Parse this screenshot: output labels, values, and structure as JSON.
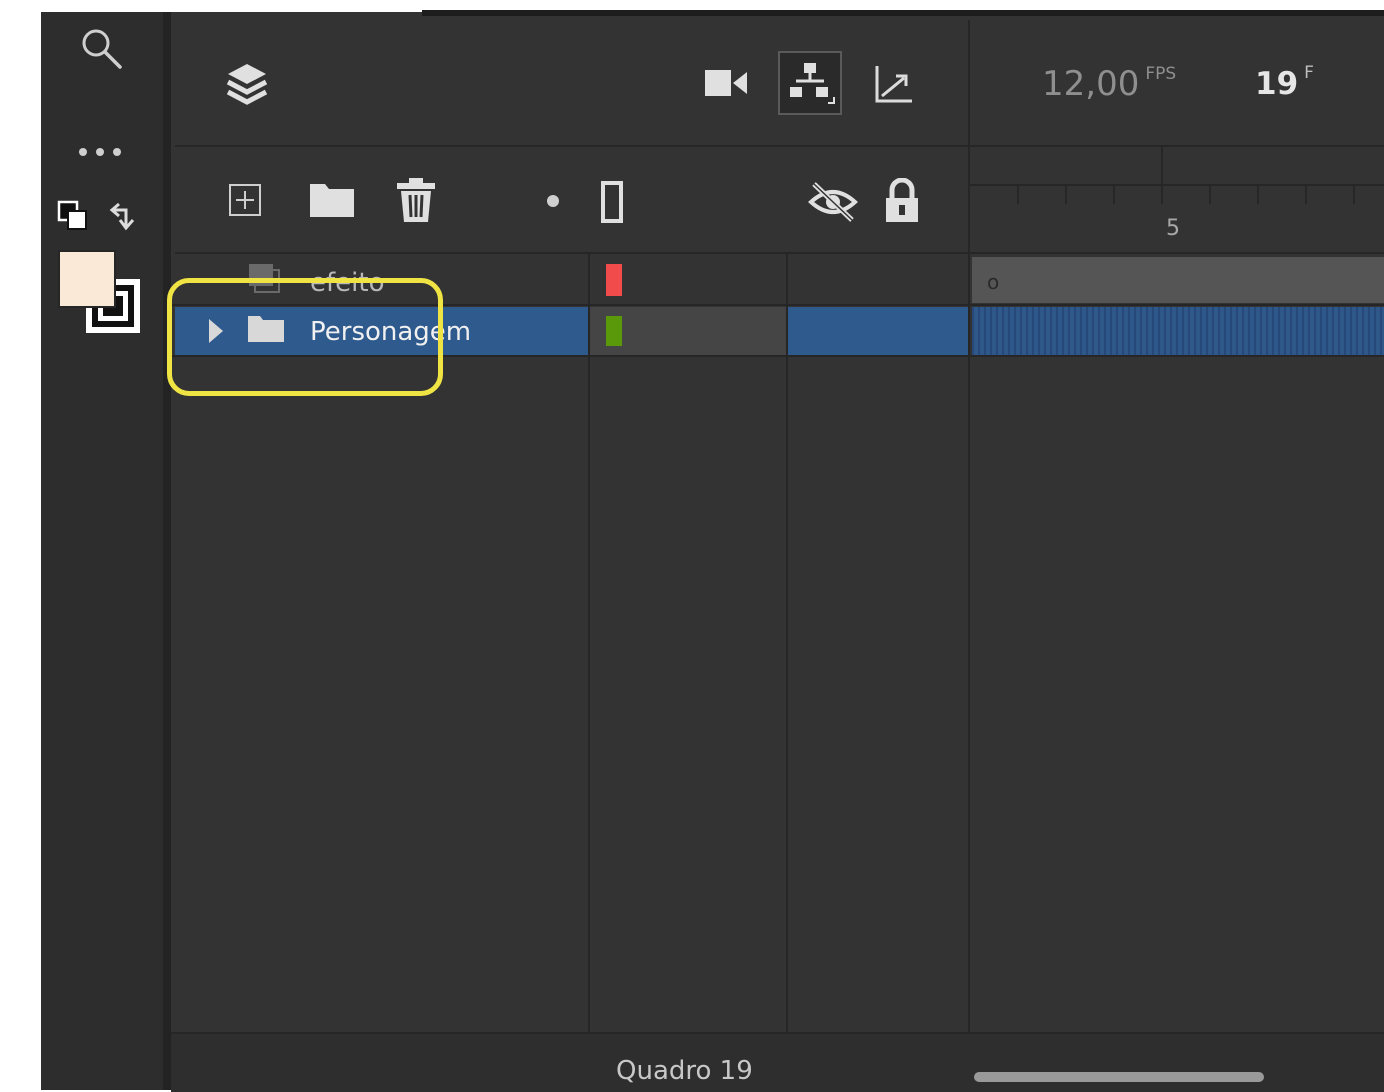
{
  "timeline": {
    "fps_value": "12,00",
    "fps_unit": "FPS",
    "frame_value": "19",
    "frame_unit": "F",
    "ruler_tick_label": "5",
    "keyframe_mark": "o"
  },
  "layers": [
    {
      "name": "efeito",
      "color": "#f24b4b",
      "selected": false,
      "type": "layer"
    },
    {
      "name": "Personagem",
      "color": "#5a9a0a",
      "selected": true,
      "type": "folder"
    }
  ],
  "status_bar": {
    "label": "Quadro",
    "frame": "19"
  },
  "colors": {
    "panel_bg": "#333333",
    "selection": "#2f5a8e",
    "highlight_annotation": "#f0e445",
    "fill_swatch": "#fbe9d8"
  },
  "icons": {
    "tools": [
      "search-icon",
      "more-icon",
      "default-colors-icon",
      "swap-colors-icon",
      "fill-stroke-swatch"
    ],
    "header": [
      "layers-icon",
      "camera-icon",
      "layer-parenting-icon",
      "graph-icon"
    ],
    "toolbar": [
      "new-layer-icon",
      "new-folder-icon",
      "delete-icon",
      "dot-icon",
      "outline-icon",
      "hide-icon",
      "lock-icon"
    ]
  }
}
